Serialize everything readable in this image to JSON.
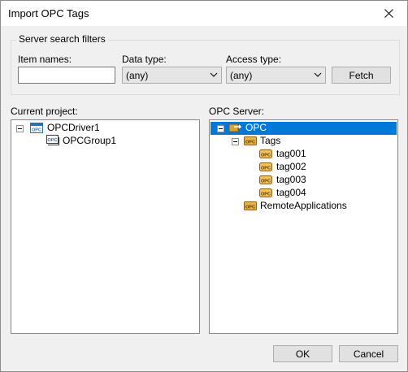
{
  "window": {
    "title": "Import OPC Tags"
  },
  "filters": {
    "group_label": "Server search filters",
    "item_names_label": "Item names:",
    "item_names_value": "",
    "data_type_label": "Data type:",
    "data_type_value": "(any)",
    "access_type_label": "Access type:",
    "access_type_value": "(any)",
    "fetch_label": "Fetch"
  },
  "current_project": {
    "label": "Current project:",
    "root": "OPCDriver1",
    "child": "OPCGroup1"
  },
  "opc_server": {
    "label": "OPC Server:",
    "root": "OPC",
    "folder": "Tags",
    "tags": [
      "tag001",
      "tag002",
      "tag003",
      "tag004"
    ],
    "remote": "RemoteApplications"
  },
  "footer": {
    "ok_label": "OK",
    "cancel_label": "Cancel"
  },
  "icon_badge": "OPC",
  "colors": {
    "selection": "#0078d7",
    "focus_border": "#0078d7"
  }
}
